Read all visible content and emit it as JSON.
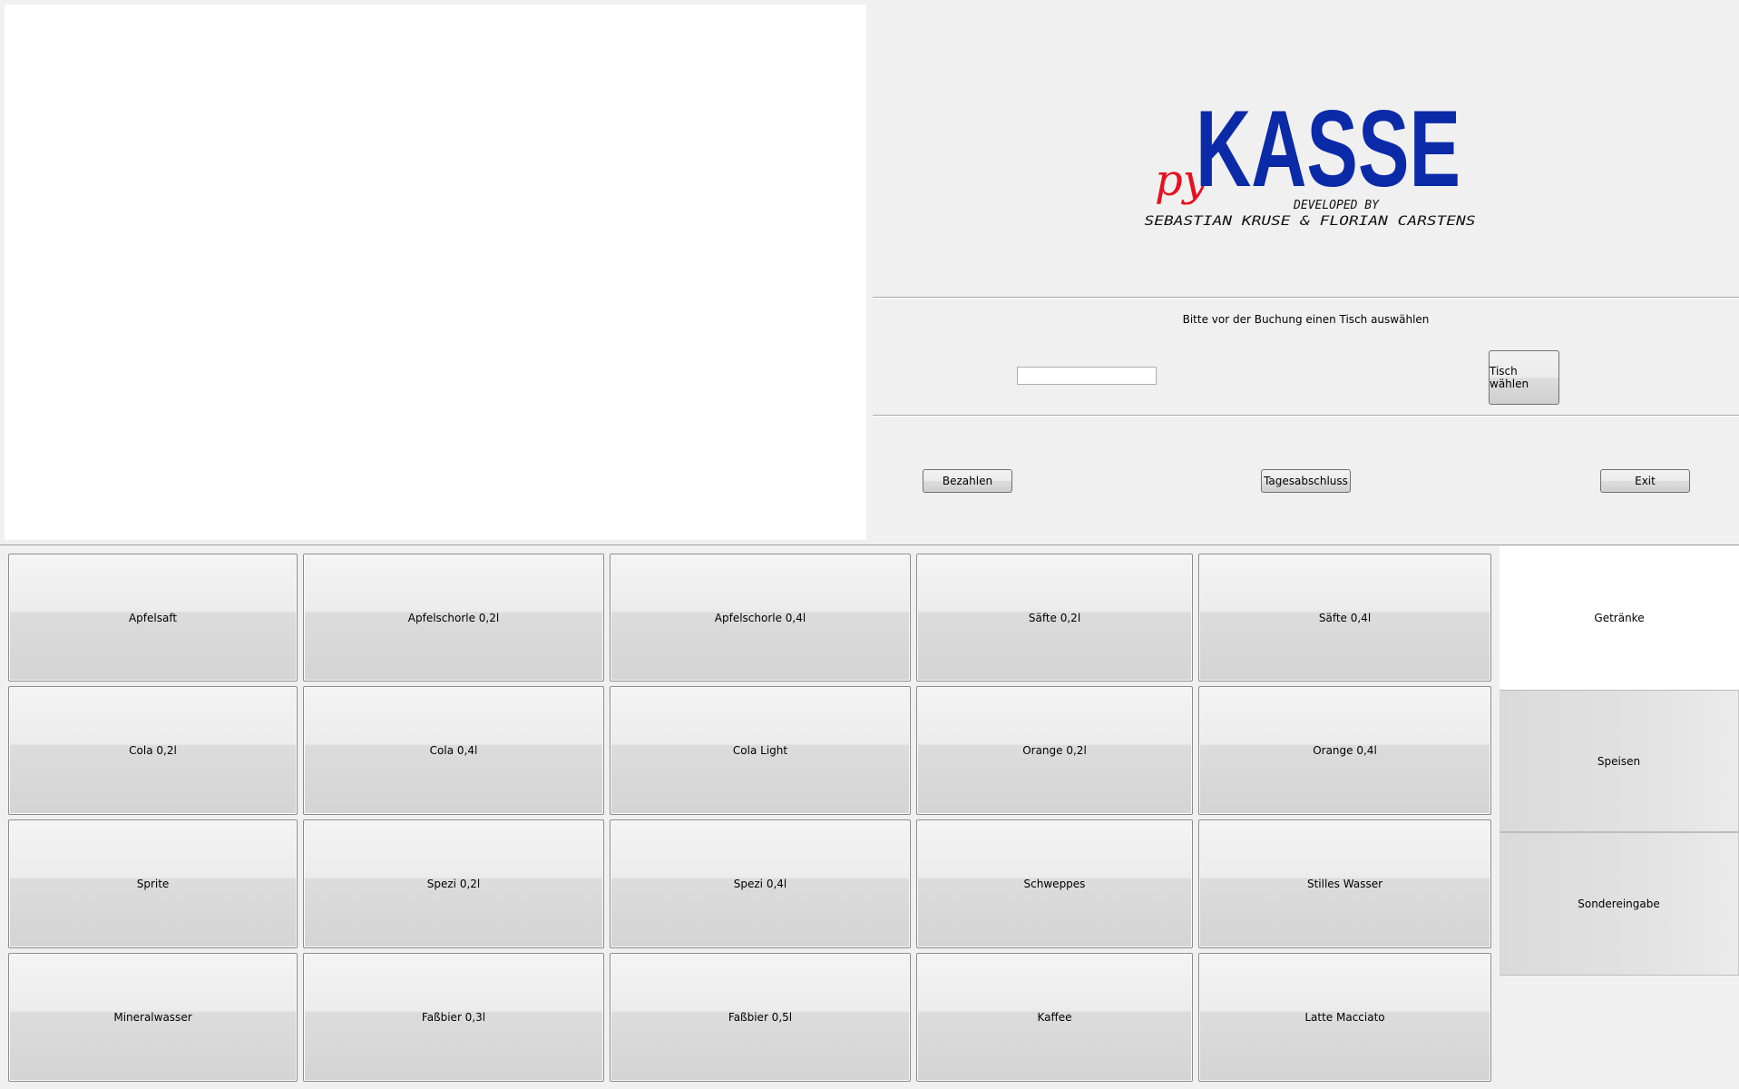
{
  "logo": {
    "prefix": "py",
    "name": "KASSE",
    "credit_line1": "DEVELOPED BY",
    "credit_line2": "SEBASTIAN KRUSE & FLORIAN CARSTENS",
    "colors": {
      "prefix": "#e8101e",
      "name": "#0b2aa8",
      "credit": "#111111"
    }
  },
  "table_selection": {
    "prompt": "Bitte vor der Buchung einen Tisch auswählen",
    "input_value": "",
    "select_button": "Tisch wählen"
  },
  "actions": {
    "pay": "Bezahlen",
    "daily_close": "Tagesabschluss",
    "exit": "Exit"
  },
  "products": [
    [
      "Apfelsaft",
      "Apfelschorle 0,2l",
      "Apfelschorle 0,4l",
      "Säfte 0,2l",
      "Säfte 0,4l"
    ],
    [
      "Cola 0,2l",
      "Cola 0,4l",
      "Cola Light",
      "Orange 0,2l",
      "Orange 0,4l"
    ],
    [
      "Sprite",
      "Spezi 0,2l",
      "Spezi 0,4l",
      "Schweppes",
      "Stilles Wasser"
    ],
    [
      "Mineralwasser",
      "Faßbier 0,3l",
      "Faßbier 0,5l",
      "Kaffee",
      "Latte Macciato"
    ]
  ],
  "categories": [
    {
      "label": "Getränke",
      "active": true
    },
    {
      "label": "Speisen",
      "active": false
    },
    {
      "label": "Sondereingabe",
      "active": false
    }
  ]
}
